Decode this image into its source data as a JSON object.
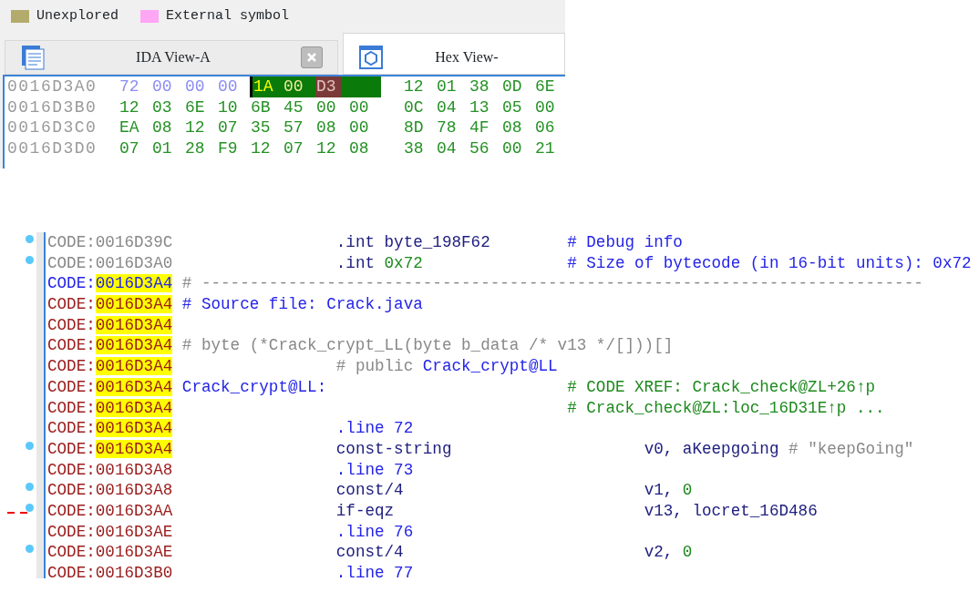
{
  "legend": [
    {
      "label": "Unexplored",
      "color": "#b3ab6b"
    },
    {
      "label": "External symbol",
      "color": "#ffa6f5"
    }
  ],
  "tabs": [
    {
      "label": "IDA View-A",
      "kind": "listing",
      "selected": false,
      "closable": true
    },
    {
      "label": "Hex View-",
      "kind": "hex",
      "selected": true,
      "closable": false
    }
  ],
  "hex_view": {
    "rows": [
      {
        "address": "0016D3A0",
        "groups": [
          {
            "bytes": [
              {
                "text": "72",
                "kind": "header"
              },
              {
                "text": "00",
                "kind": "header"
              },
              {
                "text": "00",
                "kind": "header"
              },
              {
                "text": "00",
                "kind": "header"
              },
              {
                "text": "1A",
                "kind": "cursor"
              },
              {
                "text": "00",
                "kind": "selected"
              },
              {
                "text": "D3",
                "kind": "marked"
              }
            ],
            "selection_fill": true
          },
          {
            "bytes": [
              {
                "text": "12",
                "kind": "data"
              },
              {
                "text": "01",
                "kind": "data"
              },
              {
                "text": "38",
                "kind": "data"
              },
              {
                "text": "0D",
                "kind": "data"
              },
              {
                "text": "6E",
                "kind": "data"
              }
            ]
          }
        ]
      },
      {
        "address": "0016D3B0",
        "groups": [
          {
            "bytes": [
              {
                "text": "12",
                "kind": "data"
              },
              {
                "text": "03",
                "kind": "data"
              },
              {
                "text": "6E",
                "kind": "data"
              },
              {
                "text": "10",
                "kind": "data"
              },
              {
                "text": "6B",
                "kind": "data"
              },
              {
                "text": "45",
                "kind": "data"
              },
              {
                "text": "00",
                "kind": "data"
              },
              {
                "text": "00",
                "kind": "data"
              }
            ]
          },
          {
            "bytes": [
              {
                "text": "0C",
                "kind": "data"
              },
              {
                "text": "04",
                "kind": "data"
              },
              {
                "text": "13",
                "kind": "data"
              },
              {
                "text": "05",
                "kind": "data"
              },
              {
                "text": "00",
                "kind": "data"
              }
            ]
          }
        ]
      },
      {
        "address": "0016D3C0",
        "groups": [
          {
            "bytes": [
              {
                "text": "EA",
                "kind": "data"
              },
              {
                "text": "08",
                "kind": "data"
              },
              {
                "text": "12",
                "kind": "data"
              },
              {
                "text": "07",
                "kind": "data"
              },
              {
                "text": "35",
                "kind": "data"
              },
              {
                "text": "57",
                "kind": "data"
              },
              {
                "text": "08",
                "kind": "data"
              },
              {
                "text": "00",
                "kind": "data"
              }
            ]
          },
          {
            "bytes": [
              {
                "text": "8D",
                "kind": "data"
              },
              {
                "text": "78",
                "kind": "data"
              },
              {
                "text": "4F",
                "kind": "data"
              },
              {
                "text": "08",
                "kind": "data"
              },
              {
                "text": "06",
                "kind": "data"
              }
            ]
          }
        ]
      },
      {
        "address": "0016D3D0",
        "groups": [
          {
            "bytes": [
              {
                "text": "07",
                "kind": "data"
              },
              {
                "text": "01",
                "kind": "data"
              },
              {
                "text": "28",
                "kind": "data"
              },
              {
                "text": "F9",
                "kind": "data"
              },
              {
                "text": "12",
                "kind": "data"
              },
              {
                "text": "07",
                "kind": "data"
              },
              {
                "text": "12",
                "kind": "data"
              },
              {
                "text": "08",
                "kind": "data"
              }
            ]
          },
          {
            "bytes": [
              {
                "text": "38",
                "kind": "data"
              },
              {
                "text": "04",
                "kind": "data"
              },
              {
                "text": "56",
                "kind": "data"
              },
              {
                "text": "00",
                "kind": "data"
              },
              {
                "text": "21",
                "kind": "data"
              }
            ]
          }
        ]
      }
    ]
  },
  "listing": {
    "lines": [
      {
        "segment": "CODE:",
        "address": "0016D39C",
        "color": "#888888",
        "highlighted": false,
        "marker": true,
        "jump": false,
        "parts": [
          {
            "text": ".int byte_198F62",
            "kind": "instr",
            "color": "#202080"
          },
          {
            "text": "# Debug info",
            "kind": "comment",
            "color": "#2424e8"
          }
        ]
      },
      {
        "segment": "CODE:",
        "address": "0016D3A0",
        "color": "#888888",
        "highlighted": false,
        "marker": true,
        "jump": false,
        "parts": [
          {
            "text": ".int",
            "kind": "instr",
            "color": "#202080"
          },
          {
            "text": " 0x72",
            "kind": "inline",
            "color": "#1e8a1e"
          },
          {
            "text": "# Size of bytecode (in 16-bit units): 0x72",
            "kind": "comment",
            "color": "#2424e8"
          }
        ]
      },
      {
        "segment": "CODE:",
        "address": "0016D3A4",
        "color": "#2424e8",
        "highlighted": true,
        "marker": false,
        "jump": false,
        "parts": [
          {
            "text": "# ---------------------------------------------------------------------------",
            "kind": "label",
            "color": "#888888"
          }
        ]
      },
      {
        "segment": "CODE:",
        "address": "0016D3A4",
        "color": "#9b1c1c",
        "highlighted": true,
        "marker": false,
        "jump": false,
        "parts": [
          {
            "text": "# Source file: Crack.java",
            "kind": "label",
            "color": "#2424e8"
          }
        ]
      },
      {
        "segment": "CODE:",
        "address": "0016D3A4",
        "color": "#9b1c1c",
        "highlighted": true,
        "marker": false,
        "jump": false
      },
      {
        "segment": "CODE:",
        "address": "0016D3A4",
        "color": "#9b1c1c",
        "highlighted": true,
        "marker": false,
        "jump": false,
        "parts": [
          {
            "text": "# byte (*Crack_crypt_LL(byte b_data /* v13 */[]))[]",
            "kind": "label",
            "color": "#888888"
          }
        ]
      },
      {
        "segment": "CODE:",
        "address": "0016D3A4",
        "color": "#9b1c1c",
        "highlighted": true,
        "marker": false,
        "jump": false,
        "parts": [
          {
            "text": "# public",
            "kind": "instr",
            "color": "#888888"
          },
          {
            "text": " Crack_crypt@LL",
            "kind": "inline",
            "color": "#2424e8"
          }
        ]
      },
      {
        "segment": "CODE:",
        "address": "0016D3A4",
        "color": "#9b1c1c",
        "highlighted": true,
        "marker": false,
        "jump": false,
        "parts": [
          {
            "text": "Crack_crypt@LL:",
            "kind": "label",
            "color": "#2424e8"
          },
          {
            "text": "# CODE XREF: Crack_check@ZL+26↑p",
            "kind": "comment",
            "color": "#1e8a1e"
          }
        ]
      },
      {
        "segment": "CODE:",
        "address": "0016D3A4",
        "color": "#9b1c1c",
        "highlighted": true,
        "marker": false,
        "jump": false,
        "parts": [
          {
            "text": "# Crack_check@ZL:loc_16D31E↑p ...",
            "kind": "comment",
            "color": "#1e8a1e"
          }
        ]
      },
      {
        "segment": "CODE:",
        "address": "0016D3A4",
        "color": "#9b1c1c",
        "highlighted": true,
        "marker": false,
        "jump": false,
        "parts": [
          {
            "text": ".line 72",
            "kind": "instr",
            "color": "#2424e8"
          }
        ]
      },
      {
        "segment": "CODE:",
        "address": "0016D3A4",
        "color": "#9b1c1c",
        "highlighted": true,
        "marker": true,
        "jump": false,
        "parts": [
          {
            "text": "const-string",
            "kind": "instr",
            "color": "#202080"
          },
          {
            "text": "v0, aKeepgoing",
            "kind": "operand",
            "color": "#202080"
          },
          {
            "text": " # \"keepGoing\"",
            "kind": "inline",
            "color": "#888888"
          }
        ]
      },
      {
        "segment": "CODE:",
        "address": "0016D3A8",
        "color": "#9b1c1c",
        "highlighted": false,
        "marker": false,
        "jump": false,
        "parts": [
          {
            "text": ".line 73",
            "kind": "instr",
            "color": "#2424e8"
          }
        ]
      },
      {
        "segment": "CODE:",
        "address": "0016D3A8",
        "color": "#9b1c1c",
        "highlighted": false,
        "marker": true,
        "jump": false,
        "parts": [
          {
            "text": "const/4",
            "kind": "instr",
            "color": "#202080"
          },
          {
            "text": "v1,",
            "kind": "operand",
            "color": "#202080"
          },
          {
            "text": " 0",
            "kind": "inline",
            "color": "#1e8a1e"
          }
        ]
      },
      {
        "segment": "CODE:",
        "address": "0016D3AA",
        "color": "#9b1c1c",
        "highlighted": false,
        "marker": true,
        "jump": true,
        "parts": [
          {
            "text": "if-eqz",
            "kind": "instr",
            "color": "#202080"
          },
          {
            "text": "v13, locret_16D486",
            "kind": "operand",
            "color": "#202080"
          }
        ]
      },
      {
        "segment": "CODE:",
        "address": "0016D3AE",
        "color": "#9b1c1c",
        "highlighted": false,
        "marker": false,
        "jump": false,
        "parts": [
          {
            "text": ".line 76",
            "kind": "instr",
            "color": "#2424e8"
          }
        ]
      },
      {
        "segment": "CODE:",
        "address": "0016D3AE",
        "color": "#9b1c1c",
        "highlighted": false,
        "marker": true,
        "jump": false,
        "parts": [
          {
            "text": "const/4",
            "kind": "instr",
            "color": "#202080"
          },
          {
            "text": "v2,",
            "kind": "operand",
            "color": "#202080"
          },
          {
            "text": " 0",
            "kind": "inline",
            "color": "#1e8a1e"
          }
        ]
      },
      {
        "segment": "CODE:",
        "address": "0016D3B0",
        "color": "#9b1c1c",
        "highlighted": false,
        "marker": false,
        "jump": false,
        "parts": [
          {
            "text": ".line 77",
            "kind": "instr",
            "color": "#2424e8"
          }
        ]
      }
    ]
  }
}
